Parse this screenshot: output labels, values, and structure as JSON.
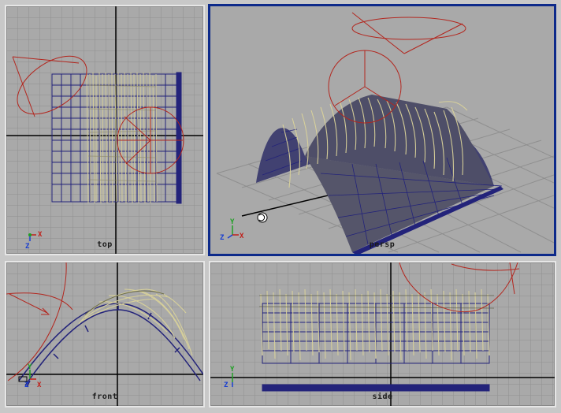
{
  "viewports": {
    "top": {
      "label": "top",
      "active": false
    },
    "persp": {
      "label": "persp",
      "active": true
    },
    "front": {
      "label": "front",
      "active": false
    },
    "side": {
      "label": "side",
      "active": false
    }
  },
  "axes": {
    "x": "X",
    "y": "Y",
    "z": "Z"
  },
  "colors": {
    "viewport_bg": "#a9a9a9",
    "grid": "#8f8f8f",
    "grid_axis": "#000000",
    "wire": "#23237a",
    "light_gizmo": "#b3261e",
    "grass": "#d9d29a",
    "active_border": "#0d2a8a"
  },
  "icons": [
    "view-axis-icon",
    "rotate-cursor-icon"
  ]
}
